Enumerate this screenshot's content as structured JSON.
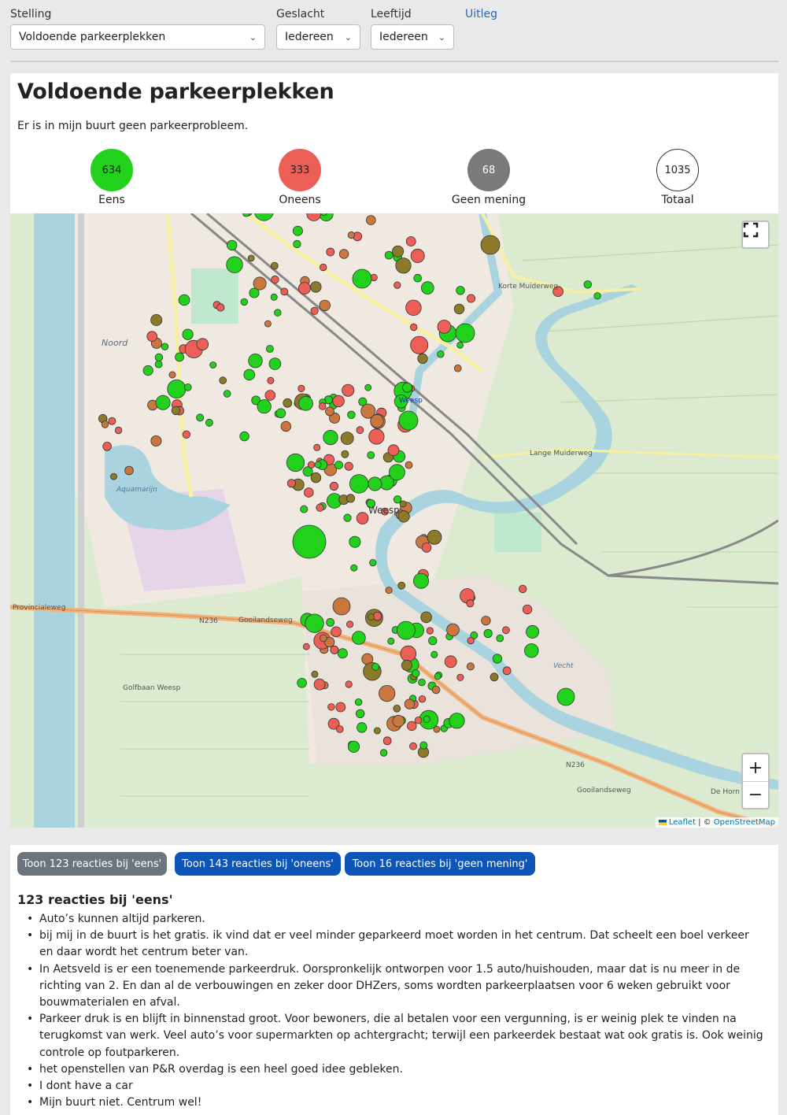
{
  "filters": {
    "stelling": {
      "label": "Stelling",
      "value": "Voldoende parkeerplekken"
    },
    "geslacht": {
      "label": "Geslacht",
      "value": "Iedereen"
    },
    "leeftijd": {
      "label": "Leeftijd",
      "value": "Iedereen"
    },
    "uitleg": "Uitleg"
  },
  "panel": {
    "title": "Voldoende parkeerplekken",
    "description": "Er is in mijn buurt geen parkeerprobleem."
  },
  "stats": [
    {
      "value": "634",
      "label": "Eens",
      "color": "#22d11c"
    },
    {
      "value": "333",
      "label": "Oneens",
      "color": "#ec5f56"
    },
    {
      "value": "68",
      "label": "Geen mening",
      "color": "#7a7a7a"
    },
    {
      "value": "1035",
      "label": "Totaal",
      "color": "#ffffff"
    }
  ],
  "map": {
    "fullscreen_icon": "fullscreen-icon",
    "zoom_in": "+",
    "zoom_out": "−",
    "attribution_leaflet": "Leaflet",
    "attribution_sep": " | © ",
    "attribution_osm": "OpenStreetMap",
    "labels": {
      "noord": "Noord",
      "weesp": "Weesp",
      "weesp_station": "Weesp",
      "n236": "N236",
      "n236b": "N236",
      "provincialeweg": "Provincialeweg",
      "gooilandseweg": "Gooilandseweg",
      "gooilandseweg2": "Gooilandseweg",
      "aquamarijn": "Aquamarijn",
      "lange_muiderweg": "Lange Muiderweg",
      "korte_muiderweg": "Korte Muiderweg",
      "vecht": "Vecht",
      "golfbaan": "Golfbaan Weesp",
      "de_horn": "De Horn"
    },
    "colors": {
      "eens": "#22d11c",
      "oneens": "#ec5f56",
      "geen": "#8a7a2a",
      "oranje": "#c9763f"
    }
  },
  "reactions": {
    "buttons": [
      {
        "label": "Toon 123 reacties bij 'eens'",
        "color": "#6c757d"
      },
      {
        "label": "Toon 143 reacties bij 'oneens'",
        "color": "#0d55b8"
      },
      {
        "label": "Toon 16 reacties bij 'geen mening'",
        "color": "#0d55b8"
      }
    ],
    "title": "123 reacties bij 'eens'",
    "items": [
      "Auto’s kunnen altijd parkeren.",
      "bij mij in de buurt is het gratis. ik vind dat er veel minder geparkeerd moet worden in het centrum. Dat scheelt een boel verkeer en daar wordt het centrum beter van.",
      "In Aetsveld is er een toenemende parkeerdruk. Oorspronkelijk ontworpen voor 1.5 auto/huishouden, maar dat is nu meer in de richting van 2. En dan al de verbouwingen en zeker door DHZers, soms wordten parkeerplaatsen voor 6 weken gebruikt voor bouwmaterialen en afval.",
      "Parkeer druk is en blijft in binnenstad groot. Voor bewoners, die al betalen voor een vergunning, is er weinig plek te vinden na terugkomst van werk. Veel auto’s voor supermarkten op achtergracht; terwijl een parkeerdek bestaat wat ook gratis is. Ook weinig controle op foutparkeren.",
      "het openstellen van P&R overdag is een heel goed idee gebleken.",
      "I dont have a car",
      "Mijn buurt niet. Centrum wel!"
    ]
  }
}
